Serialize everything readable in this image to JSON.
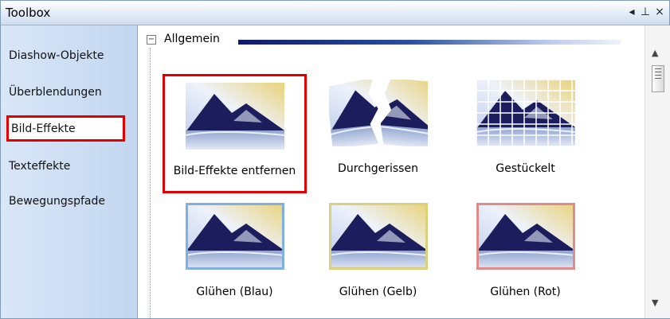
{
  "window": {
    "title": "Toolbox",
    "pin_glyph": "⊥",
    "dropdown_glyph": "◂",
    "close_glyph": "×"
  },
  "sidebar": {
    "items": [
      {
        "label": "Diashow-Objekte"
      },
      {
        "label": "Überblendungen"
      },
      {
        "label": "Bild-Effekte",
        "selected": true
      },
      {
        "label": "Texteffekte"
      },
      {
        "label": "Bewegungspfade"
      }
    ]
  },
  "group": {
    "label": "Allgemein",
    "collapse_glyph": "−"
  },
  "effects": [
    {
      "label": "Bild-Effekte entfernen",
      "style": "plain",
      "selected": true
    },
    {
      "label": "Durchgerissen",
      "style": "torn"
    },
    {
      "label": "Gestückelt",
      "style": "grid"
    },
    {
      "label": "Glühen (Blau)",
      "style": "glow",
      "glow_color": "#7fb0de"
    },
    {
      "label": "Glühen (Gelb)",
      "style": "glow",
      "glow_color": "#d9d27a"
    },
    {
      "label": "Glühen (Rot)",
      "style": "glow",
      "glow_color": "#e08a8a"
    }
  ],
  "scrollbar": {
    "up_glyph": "▲",
    "down_glyph": "▼"
  },
  "colors": {
    "selection": "#e00000",
    "mountain": "#1b1d5c",
    "sky_warm": "#e9d27a"
  }
}
